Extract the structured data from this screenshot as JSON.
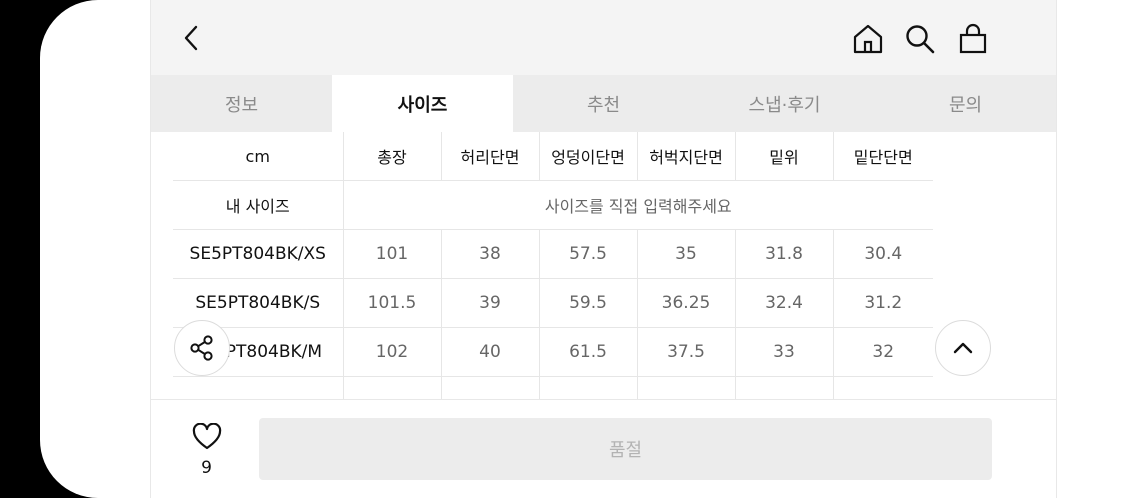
{
  "header": {
    "back_icon": "chevron-left-icon",
    "home_icon": "home-icon",
    "search_icon": "search-icon",
    "cart_icon": "shopping-bag-icon"
  },
  "tabs": [
    {
      "label": "정보",
      "active": false
    },
    {
      "label": "사이즈",
      "active": true
    },
    {
      "label": "추천",
      "active": false
    },
    {
      "label": "스냅·후기",
      "active": false
    },
    {
      "label": "문의",
      "active": false
    }
  ],
  "size_table": {
    "columns": [
      "cm",
      "총장",
      "허리단면",
      "엉덩이단면",
      "허벅지단면",
      "밑위",
      "밑단단면"
    ],
    "my_size_label": "내 사이즈",
    "my_size_prompt": "사이즈를 직접 입력해주세요",
    "rows": [
      {
        "name": "SE5PT804BK/XS",
        "values": [
          "101",
          "38",
          "57.5",
          "35",
          "31.8",
          "30.4"
        ]
      },
      {
        "name": "SE5PT804BK/S",
        "values": [
          "101.5",
          "39",
          "59.5",
          "36.25",
          "32.4",
          "31.2"
        ]
      },
      {
        "name": "SE5PT804BK/M",
        "values": [
          "102",
          "40",
          "61.5",
          "37.5",
          "33",
          "32"
        ]
      }
    ]
  },
  "floating": {
    "share_icon": "share-icon",
    "scroll_top_icon": "chevron-up-icon"
  },
  "bottom_bar": {
    "like_icon": "heart-icon",
    "like_count": "9",
    "button_label": "품절"
  }
}
